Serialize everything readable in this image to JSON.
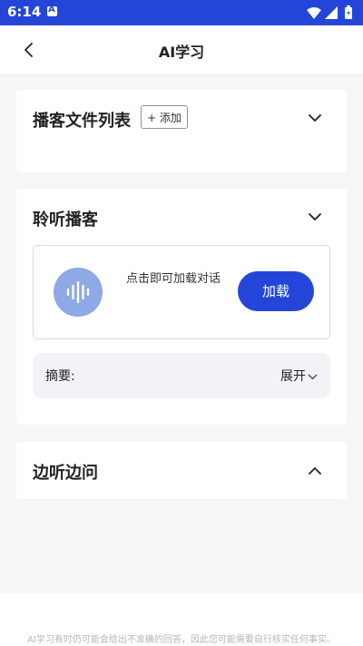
{
  "status_bar": {
    "time": "6:14",
    "icons": [
      "wifi-icon",
      "signal-icon",
      "battery-icon"
    ],
    "background": "#2446d8"
  },
  "header": {
    "title": "AI学习",
    "back_icon": "chevron-left-icon"
  },
  "sections": {
    "file_list": {
      "title": "播客文件列表",
      "add_label": "+ 添加",
      "expanded": false
    },
    "listen": {
      "title": "聆听播客",
      "expanded": false,
      "hint": "点击即可加载对话",
      "load_label": "加载",
      "summary_label": "摘要:",
      "expand_label": "展开"
    },
    "ask": {
      "title": "边听边问",
      "expanded": true
    }
  },
  "footer": {
    "disclaimer": "AI学习有时仍可能会给出不准确的回答，因此您可能需要自行核实任何事实。"
  },
  "colors": {
    "accent": "#2446d8",
    "audio_icon_bg": "#8fa8e6",
    "page_bg": "#f5f6f8"
  }
}
